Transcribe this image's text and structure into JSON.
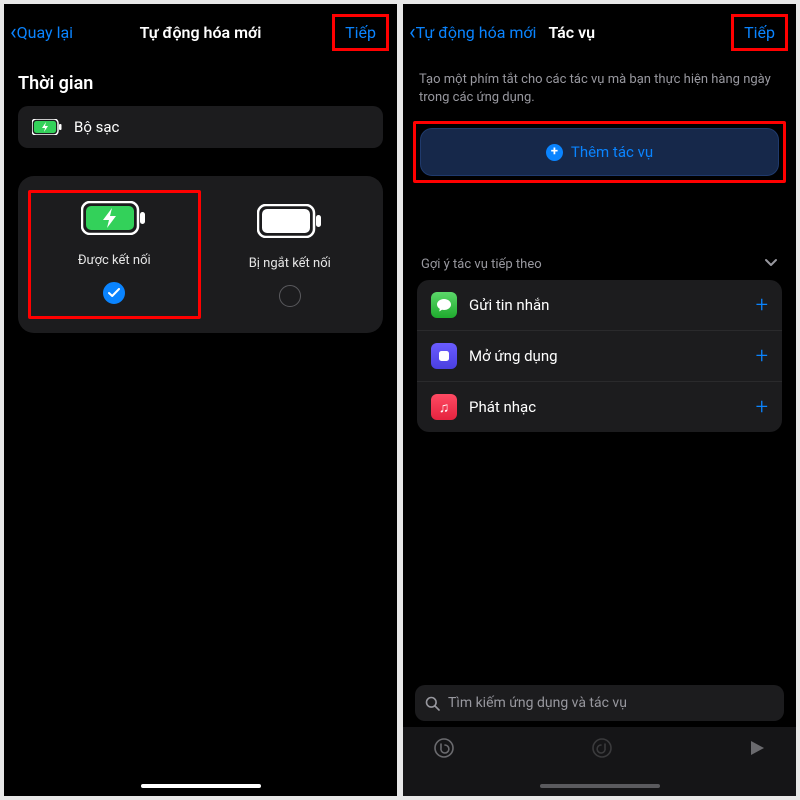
{
  "left": {
    "back_label": "Quay lại",
    "title": "Tự động hóa mới",
    "next": "Tiếp",
    "section_title": "Thời gian",
    "trigger_row": {
      "label": "Bộ sạc"
    },
    "option_connected": "Được kết nối",
    "option_disconnected": "Bị ngắt kết nối"
  },
  "right": {
    "back_label": "Tự động hóa mới",
    "title": "Tác vụ",
    "next": "Tiếp",
    "description": "Tạo một phím tắt cho các tác vụ mà bạn thực hiện hàng ngày trong các ứng dụng.",
    "add_action_label": "Thêm tác vụ",
    "suggestion_header": "Gợi ý tác vụ tiếp theo",
    "suggestions": [
      {
        "label": "Gửi tin nhắn",
        "icon": "messages"
      },
      {
        "label": "Mở ứng dụng",
        "icon": "open-app"
      },
      {
        "label": "Phát nhạc",
        "icon": "music"
      }
    ],
    "search_placeholder": "Tìm kiếm ứng dụng và tác vụ"
  }
}
